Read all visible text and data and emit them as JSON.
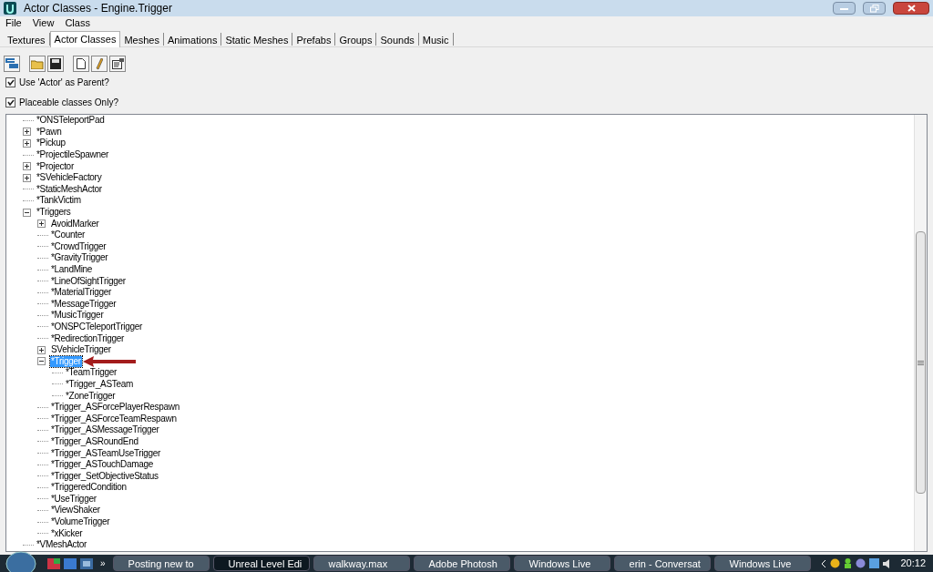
{
  "window": {
    "title": "Actor Classes - Engine.Trigger"
  },
  "menu": [
    "File",
    "View",
    "Class"
  ],
  "tabs": [
    {
      "label": "Textures",
      "selected": false
    },
    {
      "label": "Actor Classes",
      "selected": true
    },
    {
      "label": "Meshes",
      "selected": false
    },
    {
      "label": "Animations",
      "selected": false
    },
    {
      "label": "Static Meshes",
      "selected": false
    },
    {
      "label": "Prefabs",
      "selected": false
    },
    {
      "label": "Groups",
      "selected": false
    },
    {
      "label": "Sounds",
      "selected": false
    },
    {
      "label": "Music",
      "selected": false
    }
  ],
  "options": [
    {
      "label": "Use 'Actor' as Parent?",
      "checked": true
    },
    {
      "label": "Placeable classes Only?",
      "checked": true
    }
  ],
  "tree": [
    {
      "label": "*ONSTeleportPad",
      "expandable": false
    },
    {
      "label": "*Pawn",
      "expandable": true,
      "expanded": false
    },
    {
      "label": "*Pickup",
      "expandable": true,
      "expanded": false
    },
    {
      "label": "*ProjectileSpawner",
      "expandable": false
    },
    {
      "label": "*Projector",
      "expandable": true,
      "expanded": false
    },
    {
      "label": "*SVehicleFactory",
      "expandable": true,
      "expanded": false
    },
    {
      "label": "*StaticMeshActor",
      "expandable": false
    },
    {
      "label": "*TankVictim",
      "expandable": false
    },
    {
      "label": "*Triggers",
      "expandable": true,
      "expanded": true,
      "children": [
        {
          "label": "AvoidMarker",
          "expandable": true,
          "expanded": false
        },
        {
          "label": "*Counter",
          "expandable": false
        },
        {
          "label": "*CrowdTrigger",
          "expandable": false
        },
        {
          "label": "*GravityTrigger",
          "expandable": false
        },
        {
          "label": "*LandMine",
          "expandable": false
        },
        {
          "label": "*LineOfSightTrigger",
          "expandable": false
        },
        {
          "label": "*MaterialTrigger",
          "expandable": false
        },
        {
          "label": "*MessageTrigger",
          "expandable": false
        },
        {
          "label": "*MusicTrigger",
          "expandable": false
        },
        {
          "label": "*ONSPCTeleportTrigger",
          "expandable": false
        },
        {
          "label": "*RedirectionTrigger",
          "expandable": false
        },
        {
          "label": "SVehicleTrigger",
          "expandable": true,
          "expanded": false
        },
        {
          "label": "*Trigger",
          "expandable": true,
          "expanded": true,
          "selected": true,
          "children": [
            {
              "label": "*TeamTrigger",
              "expandable": false
            },
            {
              "label": "*Trigger_ASTeam",
              "expandable": false
            },
            {
              "label": "*ZoneTrigger",
              "expandable": false
            }
          ]
        },
        {
          "label": "*Trigger_ASForcePlayerRespawn",
          "expandable": false
        },
        {
          "label": "*Trigger_ASForceTeamRespawn",
          "expandable": false
        },
        {
          "label": "*Trigger_ASMessageTrigger",
          "expandable": false
        },
        {
          "label": "*Trigger_ASRoundEnd",
          "expandable": false
        },
        {
          "label": "*Trigger_ASTeamUseTrigger",
          "expandable": false
        },
        {
          "label": "*Trigger_ASTouchDamage",
          "expandable": false
        },
        {
          "label": "*Trigger_SetObjectiveStatus",
          "expandable": false
        },
        {
          "label": "*TriggeredCondition",
          "expandable": false
        },
        {
          "label": "*UseTrigger",
          "expandable": false
        },
        {
          "label": "*ViewShaker",
          "expandable": false
        },
        {
          "label": "*VolumeTrigger",
          "expandable": false
        },
        {
          "label": "*xKicker",
          "expandable": false
        }
      ]
    },
    {
      "label": "*VMeshActor",
      "expandable": false
    }
  ],
  "taskbar": {
    "overflow": "»",
    "buttons": [
      {
        "label": "Posting new to",
        "selected": false
      },
      {
        "label": "Unreal Level Edi",
        "selected": true
      },
      {
        "label": "walkway.max",
        "selected": false
      },
      {
        "label": "Adobe Photosh",
        "selected": false
      },
      {
        "label": "Windows Live",
        "selected": false
      },
      {
        "label": "erin - Conversat",
        "selected": false
      },
      {
        "label": "Windows Live",
        "selected": false
      }
    ],
    "clock": "20:12"
  }
}
